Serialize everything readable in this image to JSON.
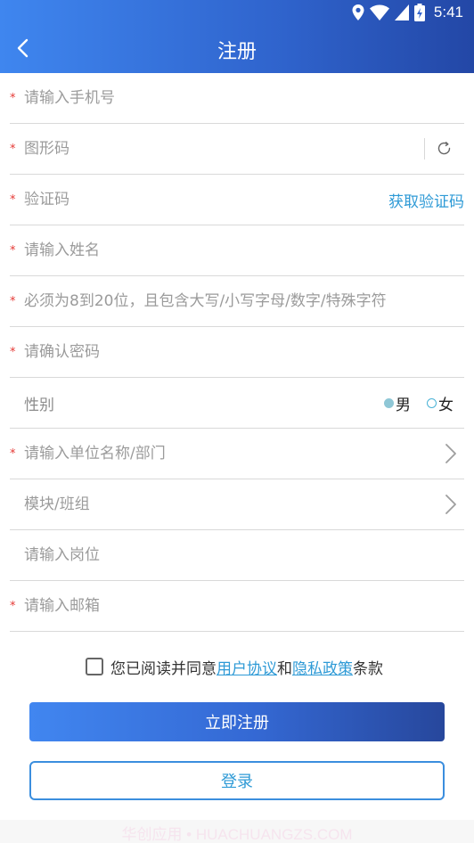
{
  "status_bar": {
    "time": "5:41",
    "icons": [
      "location-icon",
      "wifi-icon",
      "signal-icon",
      "battery-icon"
    ]
  },
  "header": {
    "title": "注册",
    "back_icon": "chevron-left-icon"
  },
  "form": {
    "phone": {
      "placeholder": "请输入手机号",
      "required": "*"
    },
    "captcha": {
      "placeholder": "图形码",
      "required": "*",
      "refresh_icon": "refresh-icon"
    },
    "sms_code": {
      "placeholder": "验证码",
      "required": "*",
      "action_label": "获取验证码"
    },
    "name": {
      "placeholder": "请输入姓名",
      "required": "*"
    },
    "password": {
      "placeholder": "必须为8到20位，且包含大写/小写字母/数字/特殊字符",
      "required": "*"
    },
    "confirm_password": {
      "placeholder": "请确认密码",
      "required": "*"
    },
    "gender": {
      "label": "性别",
      "options": [
        {
          "label": "男",
          "selected": true
        },
        {
          "label": "女",
          "selected": false
        }
      ]
    },
    "department": {
      "placeholder": "请输入单位名称/部门",
      "required": "*"
    },
    "module": {
      "placeholder": "模块/班组"
    },
    "position": {
      "placeholder": "请输入岗位"
    },
    "email": {
      "placeholder": "请输入邮箱",
      "required": "*"
    }
  },
  "agreement": {
    "prefix": "您已阅读并同意",
    "user_agreement": "用户协议",
    "and": "和",
    "privacy_policy": "隐私政策",
    "suffix": "条款",
    "checked": false
  },
  "buttons": {
    "register": "立即注册",
    "login": "登录"
  },
  "watermark": "华创应用 • HUACHUANGZS.COM",
  "colors": {
    "header_start": "#3f86ef",
    "header_end": "#2347a6",
    "accent_link": "#2e9ad6",
    "required": "#e53935"
  }
}
